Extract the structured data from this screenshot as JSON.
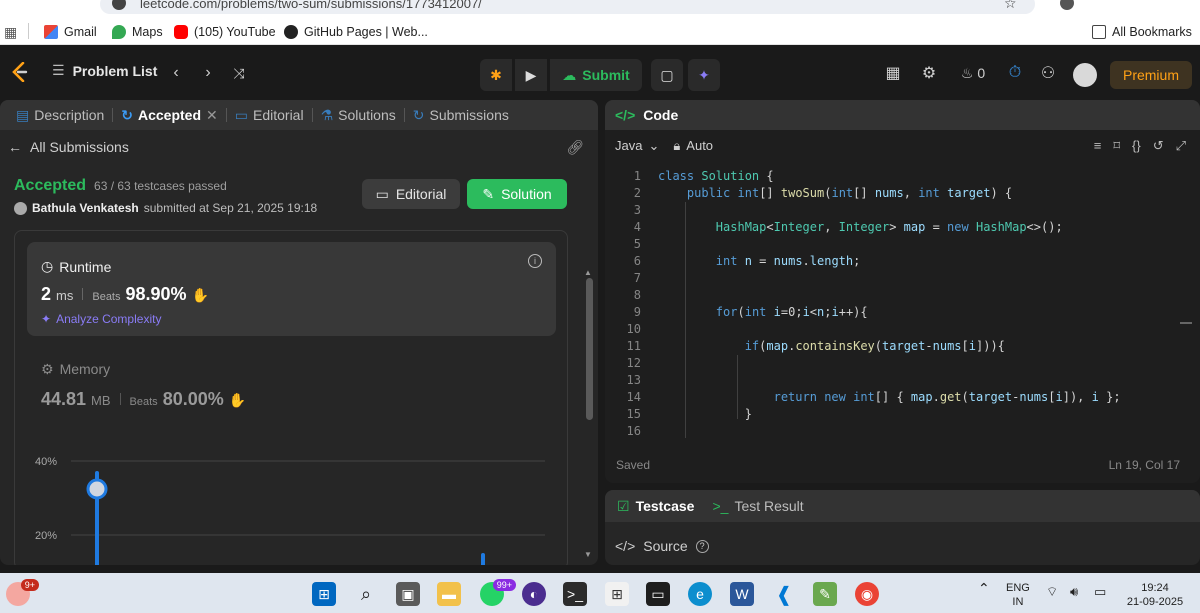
{
  "browser": {
    "url": "leetcode.com/problems/two-sum/submissions/1773412007/",
    "bookmarks": [
      {
        "label": "Gmail",
        "icon": "gmail-icon"
      },
      {
        "label": "Maps",
        "icon": "maps-icon"
      },
      {
        "label": "(105) YouTube",
        "icon": "youtube-icon"
      },
      {
        "label": "GitHub Pages | Web...",
        "icon": "github-icon"
      }
    ],
    "all_bookmarks": "All Bookmarks"
  },
  "nav": {
    "problem_list": "Problem List",
    "submit": "Submit",
    "fire_count": "0",
    "premium": "Premium"
  },
  "left_tabs": [
    {
      "label": "Description",
      "icon": "description-icon"
    },
    {
      "label": "Accepted",
      "icon": "history-icon",
      "active": true,
      "closable": true
    },
    {
      "label": "Editorial",
      "icon": "book-icon"
    },
    {
      "label": "Solutions",
      "icon": "flask-icon"
    },
    {
      "label": "Submissions",
      "icon": "history-icon"
    }
  ],
  "submission": {
    "back_label": "All Submissions",
    "status": "Accepted",
    "testcases": "63 / 63 testcases passed",
    "author": "Bathula Venkatesh",
    "submitted_at": "submitted at Sep 21, 2025 19:18",
    "editorial_btn": "Editorial",
    "solution_btn": "Solution"
  },
  "runtime": {
    "title": "Runtime",
    "value": "2",
    "unit": "ms",
    "beats_label": "Beats",
    "beats_pct": "98.90%",
    "analyze": "Analyze Complexity"
  },
  "memory": {
    "title": "Memory",
    "value": "44.81",
    "unit": "MB",
    "beats_label": "Beats",
    "beats_pct": "80.00%"
  },
  "chart_data": {
    "type": "bar",
    "y_ticks": [
      "40%",
      "20%"
    ],
    "ylim": [
      0,
      45
    ]
  },
  "editor": {
    "title": "Code",
    "language": "Java",
    "mode": "Auto",
    "status": "Saved",
    "cursor": "Ln 19, Col 17",
    "lines": [
      "class Solution {",
      "    public int[] twoSum(int[] nums, int target) {",
      "",
      "        HashMap<Integer, Integer> map = new HashMap<>();",
      "",
      "        int n = nums.length;",
      "",
      "",
      "        for(int i=0;i<n;i++){",
      "",
      "            if(map.containsKey(target-nums[i])){",
      "",
      "",
      "                return new int[] { map.get(target-nums[i]), i };",
      "            }",
      ""
    ]
  },
  "bottom": {
    "testcase": "Testcase",
    "test_result": "Test Result",
    "source": "Source"
  },
  "taskbar": {
    "notif_badge": "9+",
    "whatsapp_badge": "99+",
    "lang": "ENG",
    "region": "IN",
    "time": "19:24",
    "date": "21-09-2025"
  },
  "colors": {
    "accent_green": "#2cbb5d",
    "premium_orange": "#ffa116",
    "analyze_purple": "#8a7cf6",
    "bar_blue": "#1f7ae0"
  }
}
